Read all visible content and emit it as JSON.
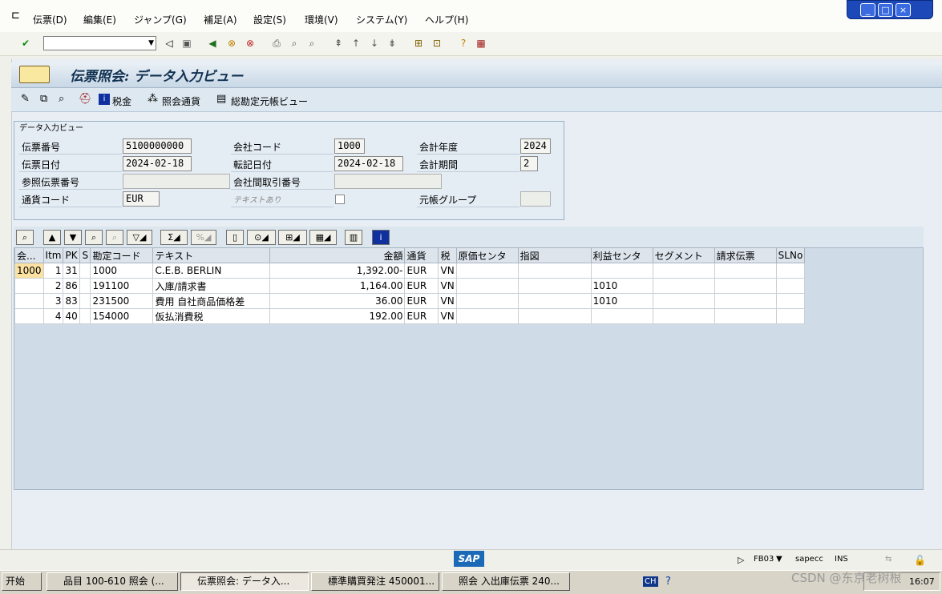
{
  "menubar": {
    "items": [
      "伝票(D)",
      "編集(E)",
      "ジャンプ(G)",
      "補足(A)",
      "設定(S)",
      "環境(V)",
      "システム(Y)",
      "ヘルプ(H)"
    ]
  },
  "window_controls": [
    "_",
    "□",
    "×"
  ],
  "toolbar": {
    "command_field_value": ""
  },
  "title": {
    "text": "伝票照会: データ入力ビュー"
  },
  "app_toolbar": {
    "tax_label": "税金",
    "currency_label": "照会通貨",
    "gl_view_label": "総勘定元帳ビュー"
  },
  "header": {
    "group_title": "データ入力ビュー",
    "doc_number_label": "伝票番号",
    "doc_number_value": "5100000000",
    "doc_date_label": "伝票日付",
    "doc_date_value": "2024-02-18",
    "ref_doc_label": "参照伝票番号",
    "ref_doc_value": "",
    "currency_label": "通貨コード",
    "currency_value": "EUR",
    "company_code_label": "会社コード",
    "company_code_value": "1000",
    "posting_date_label": "転記日付",
    "posting_date_value": "2024-02-18",
    "intercompany_label": "会社間取引番号",
    "intercompany_value": "",
    "text_exists_label": "テキストあり",
    "fiscal_year_label": "会計年度",
    "fiscal_year_value": "2024",
    "period_label": "会計期間",
    "period_value": "2",
    "ledger_group_label": "元帳グループ",
    "ledger_group_value": ""
  },
  "table": {
    "headers": [
      "会...",
      "Itm",
      "PK",
      "S",
      "勘定コード",
      "テキスト",
      "金額",
      "通貨",
      "税",
      "原価センタ",
      "指図",
      "利益センタ",
      "セグメント",
      "請求伝票",
      "SLNo"
    ],
    "rows": [
      [
        "1000",
        "1",
        "31",
        "",
        "1000",
        "C.E.B. BERLIN",
        "1,392.00-",
        "EUR",
        "VN",
        "",
        "",
        "",
        "",
        "",
        ""
      ],
      [
        "",
        "2",
        "86",
        "",
        "191100",
        "入庫/請求書",
        "1,164.00",
        "EUR",
        "VN",
        "",
        "",
        "1010",
        "",
        "",
        ""
      ],
      [
        "",
        "3",
        "83",
        "",
        "231500",
        "費用 自社商品価格差",
        "36.00",
        "EUR",
        "VN",
        "",
        "",
        "1010",
        "",
        "",
        ""
      ],
      [
        "",
        "4",
        "40",
        "",
        "154000",
        "仮払消費税",
        "192.00",
        "EUR",
        "VN",
        "",
        "",
        "",
        "",
        "",
        ""
      ]
    ]
  },
  "status_bar": {
    "logo": "SAP",
    "transaction": "FB03",
    "server": "sapecc",
    "mode": "INS"
  },
  "taskbar": {
    "start": "开始",
    "tasks": [
      "品目 100-610 照会 (...",
      "伝票照会: データ入...",
      "標準購買発注 450001...",
      "照会 入出庫伝票 240..."
    ],
    "lang": "CH",
    "clock": "16:07"
  },
  "watermark": "CSDN @东京老树根"
}
